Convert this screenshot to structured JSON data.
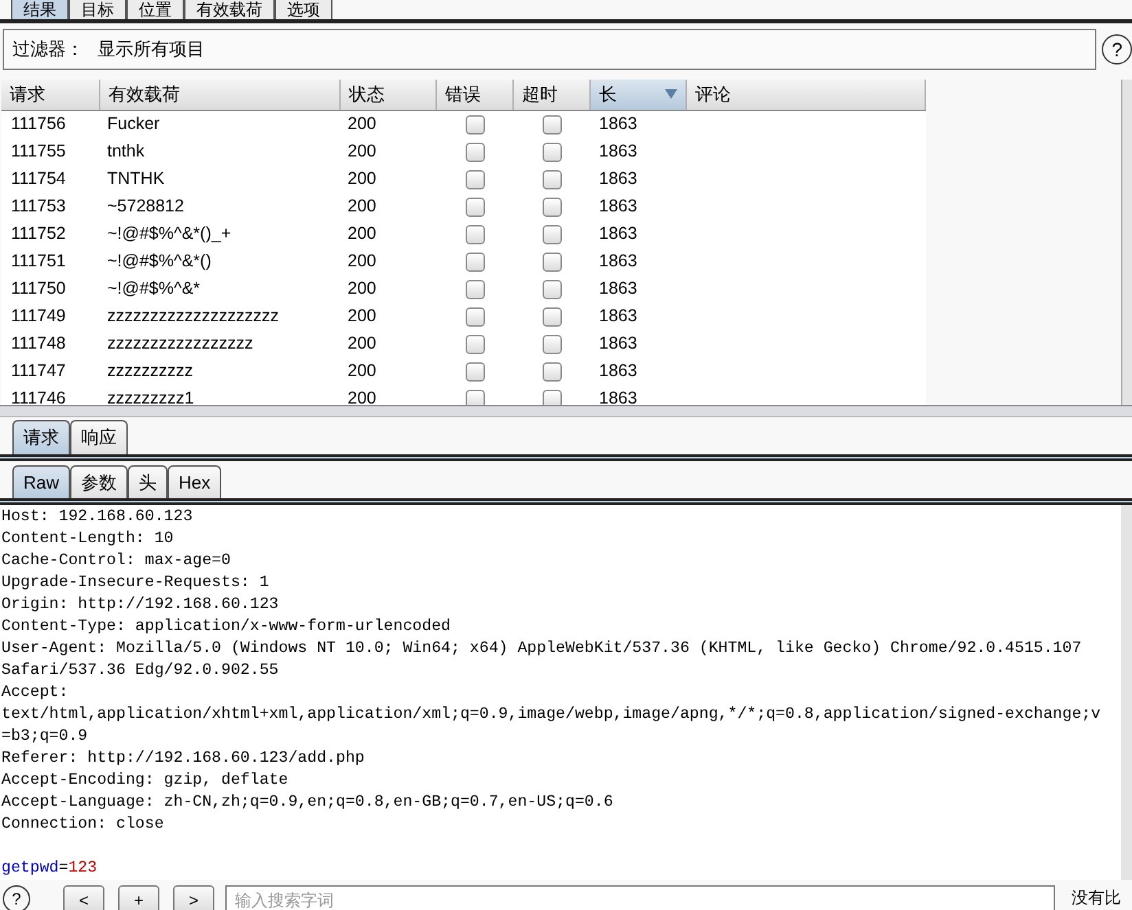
{
  "top_tabs": [
    {
      "label": "结果",
      "selected": true
    },
    {
      "label": "目标",
      "selected": false
    },
    {
      "label": "位置",
      "selected": false
    },
    {
      "label": "有效载荷",
      "selected": false
    },
    {
      "label": "选项",
      "selected": false
    }
  ],
  "filter": {
    "label": "过滤器：",
    "value": "显示所有项目",
    "help": "?"
  },
  "table": {
    "columns": [
      {
        "label": "请求",
        "sorted": false
      },
      {
        "label": "有效载荷",
        "sorted": false
      },
      {
        "label": "状态",
        "sorted": false
      },
      {
        "label": "错误",
        "sorted": false
      },
      {
        "label": "超时",
        "sorted": false
      },
      {
        "label": "长",
        "sorted": true
      },
      {
        "label": "评论",
        "sorted": false
      }
    ],
    "rows": [
      {
        "request": "111756",
        "payload": "Fucker",
        "status": "200",
        "error": false,
        "timeout": false,
        "length": "1863"
      },
      {
        "request": "111755",
        "payload": "tnthk",
        "status": "200",
        "error": false,
        "timeout": false,
        "length": "1863"
      },
      {
        "request": "111754",
        "payload": "TNTHK",
        "status": "200",
        "error": false,
        "timeout": false,
        "length": "1863"
      },
      {
        "request": "111753",
        "payload": "~5728812",
        "status": "200",
        "error": false,
        "timeout": false,
        "length": "1863"
      },
      {
        "request": "111752",
        "payload": "~!@#$%^&*()_+",
        "status": "200",
        "error": false,
        "timeout": false,
        "length": "1863"
      },
      {
        "request": "111751",
        "payload": "~!@#$%^&*()",
        "status": "200",
        "error": false,
        "timeout": false,
        "length": "1863"
      },
      {
        "request": "111750",
        "payload": "~!@#$%^&*",
        "status": "200",
        "error": false,
        "timeout": false,
        "length": "1863"
      },
      {
        "request": "111749",
        "payload": "zzzzzzzzzzzzzzzzzzzz",
        "status": "200",
        "error": false,
        "timeout": false,
        "length": "1863"
      },
      {
        "request": "111748",
        "payload": "zzzzzzzzzzzzzzzzz",
        "status": "200",
        "error": false,
        "timeout": false,
        "length": "1863"
      },
      {
        "request": "111747",
        "payload": "zzzzzzzzzz",
        "status": "200",
        "error": false,
        "timeout": false,
        "length": "1863"
      },
      {
        "request": "111746",
        "payload": "zzzzzzzzz1",
        "status": "200",
        "error": false,
        "timeout": false,
        "length": "1863"
      }
    ]
  },
  "message_tabs": [
    {
      "label": "请求",
      "selected": true
    },
    {
      "label": "响应",
      "selected": false
    }
  ],
  "view_tabs": [
    {
      "label": "Raw",
      "selected": true
    },
    {
      "label": "参数",
      "selected": false
    },
    {
      "label": "头",
      "selected": false
    },
    {
      "label": "Hex",
      "selected": false
    }
  ],
  "headers": [
    "Host: 192.168.60.123",
    "Content-Length: 10",
    "Cache-Control: max-age=0",
    "Upgrade-Insecure-Requests: 1",
    "Origin: http://192.168.60.123",
    "Content-Type: application/x-www-form-urlencoded",
    "User-Agent: Mozilla/5.0 (Windows NT 10.0; Win64; x64) AppleWebKit/537.36 (KHTML, like Gecko) Chrome/92.0.4515.107",
    "Safari/537.36 Edg/92.0.902.55",
    "Accept:",
    "text/html,application/xhtml+xml,application/xml;q=0.9,image/webp,image/apng,*/*;q=0.8,application/signed-exchange;v",
    "=b3;q=0.9",
    "Referer: http://192.168.60.123/add.php",
    "Accept-Encoding: gzip, deflate",
    "Accept-Language: zh-CN,zh;q=0.9,en;q=0.8,en-GB;q=0.7,en-US;q=0.6",
    "Connection: close"
  ],
  "body": [
    {
      "kind": "name",
      "text": "getpwd"
    },
    {
      "kind": "operator",
      "text": "="
    },
    {
      "kind": "value",
      "text": "123"
    }
  ],
  "search_bar": {
    "help": "?",
    "buttons": [
      "<",
      "+",
      ">"
    ],
    "placeholder": "输入搜索字词",
    "matches": "没有比"
  }
}
